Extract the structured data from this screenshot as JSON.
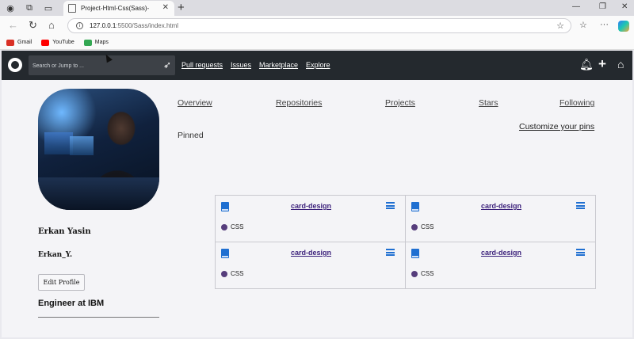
{
  "browser": {
    "tab_title": "Project-Html-Css(Sass)-",
    "url_host": "127.0.0.1",
    "url_path": ":5500/Sass/index.html",
    "bookmarks": [
      {
        "label": "Gmail",
        "color": "#d93025"
      },
      {
        "label": "YouTube",
        "color": "#ff0000"
      },
      {
        "label": "Maps",
        "color": "#34a853"
      }
    ]
  },
  "github_header": {
    "search_placeholder": "Search or Jump to ...",
    "links": [
      "Pull requests",
      "Issues",
      "Marketplace",
      "Explore"
    ]
  },
  "profile": {
    "name": "Erkan Yasin",
    "username": "Erkan_Y.",
    "edit_button": "Edit Profile",
    "job": "Engineer at IBM"
  },
  "profile_tabs": [
    "Overview",
    "Repositories",
    "Projects",
    "Stars",
    "Following"
  ],
  "customize_link": "Customize your pins",
  "pinned_label": "Pinned",
  "cards": [
    {
      "title": "card-design",
      "language": "CSS",
      "language_color": "#563d7c"
    },
    {
      "title": "card-design",
      "language": "CSS",
      "language_color": "#563d7c"
    },
    {
      "title": "card-design",
      "language": "CSS",
      "language_color": "#563d7c"
    },
    {
      "title": "card-design",
      "language": "CSS",
      "language_color": "#563d7c"
    }
  ],
  "colors": {
    "header_bg": "#24292e",
    "accent_blue": "#1f6fd1",
    "card_title": "#3a1f7a"
  }
}
